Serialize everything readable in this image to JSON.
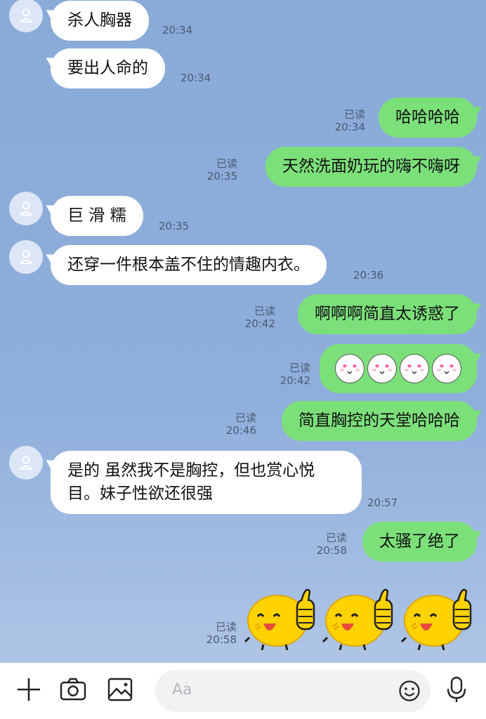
{
  "messages": [
    {
      "side": "in",
      "text": "杀人胸器",
      "time": "20:34"
    },
    {
      "side": "in",
      "text": "要出人命的",
      "time": "20:34"
    },
    {
      "side": "out",
      "text": "哈哈哈哈",
      "read": "已读",
      "time": "20:34"
    },
    {
      "side": "out",
      "text": "天然洗面奶玩的嗨不嗨呀",
      "read": "已读",
      "time": "20:35"
    },
    {
      "side": "in",
      "text": "巨 滑 糯",
      "time": "20:35"
    },
    {
      "side": "in",
      "text": "还穿一件根本盖不住的情趣内衣。",
      "time": "20:36"
    },
    {
      "side": "out",
      "text": "啊啊啊简直太诱惑了",
      "read": "已读",
      "time": "20:42"
    },
    {
      "side": "out",
      "read": "已读",
      "time": "20:42",
      "emoji": "heart-eyes-face"
    },
    {
      "side": "out",
      "text": "简直胸控的天堂哈哈哈",
      "read": "已读",
      "time": "20:46"
    },
    {
      "side": "in",
      "text_line1": "是的 虽然我不是胸控，但也赏心悦",
      "text_line2": "目。妹子性欲还很强",
      "time": "20:57"
    },
    {
      "side": "out",
      "text": "太骚了绝了",
      "read": "已读",
      "time": "20:58"
    },
    {
      "side": "out",
      "read": "已读",
      "time": "20:58",
      "sticker": "yellow-thumbs-up-chick"
    }
  ],
  "input": {
    "placeholder": "Aa"
  },
  "colors": {
    "outgoing": "#7ce07a",
    "incoming": "#ffffff",
    "background": "#8aaad8"
  },
  "icons": [
    "plus-icon",
    "camera-icon",
    "image-icon",
    "emoji-icon",
    "microphone-icon"
  ]
}
